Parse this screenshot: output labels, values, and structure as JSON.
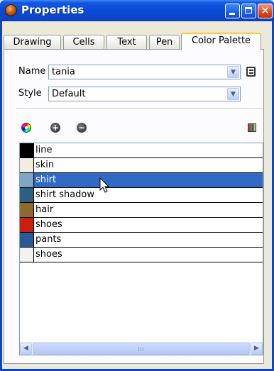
{
  "window": {
    "title": "Properties"
  },
  "tabs": [
    "Drawing",
    "Cells",
    "Text",
    "Pen",
    "Color Palette"
  ],
  "active_tab": "Color Palette",
  "fields": {
    "name_label": "Name",
    "name_value": "tania",
    "style_label": "Style",
    "style_value": "Default"
  },
  "palette": [
    {
      "label": "line",
      "color": "#000000",
      "selected": false
    },
    {
      "label": "skin",
      "color": "#f2ece2",
      "selected": false
    },
    {
      "label": "shirt",
      "color": "#7fa6c4",
      "selected": true
    },
    {
      "label": "shirt shadow",
      "color": "#2c5f82",
      "selected": false
    },
    {
      "label": "hair",
      "color": "#8c6a2e",
      "selected": false
    },
    {
      "label": "shoes",
      "color": "#cc1e0e",
      "selected": false
    },
    {
      "label": "pants",
      "color": "#2a5a96",
      "selected": false
    },
    {
      "label": "shoes",
      "color": "#f2f2ee",
      "selected": false
    }
  ],
  "scrollbar": {
    "grip_symbol": "III"
  }
}
